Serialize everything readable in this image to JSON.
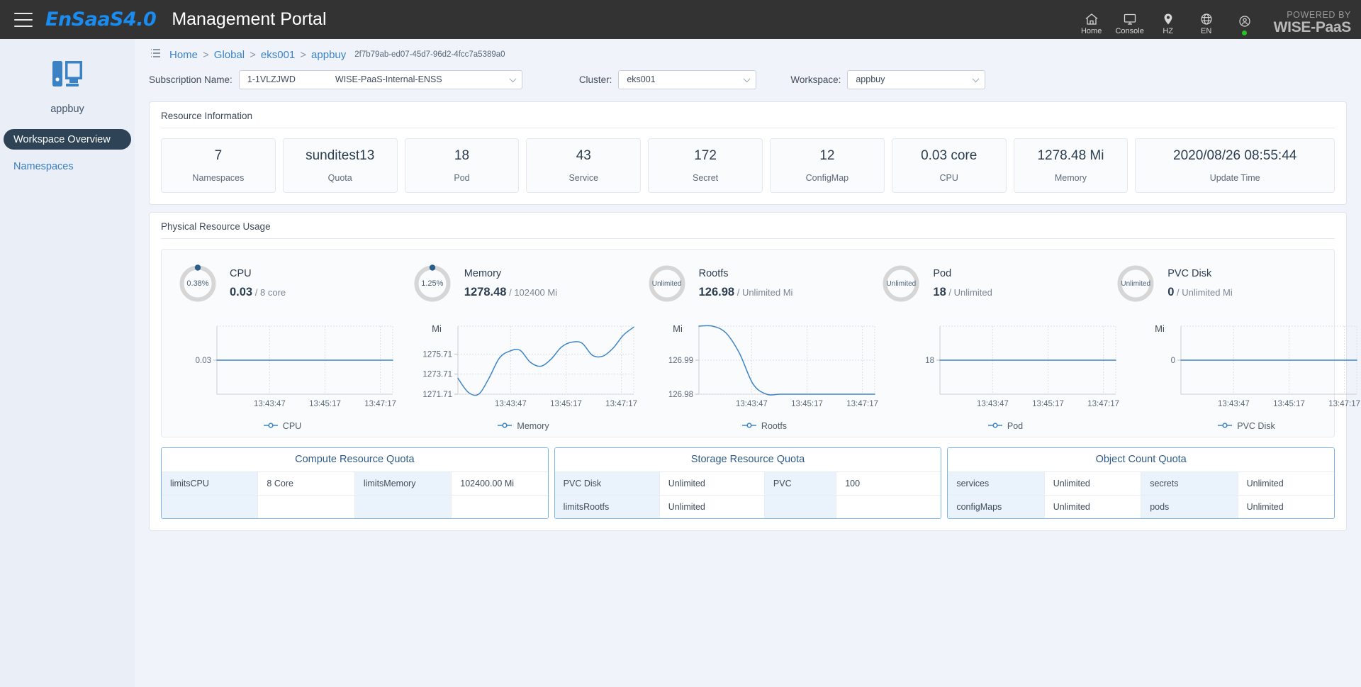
{
  "header": {
    "menu_icon": "hamburger-menu-icon",
    "brand": "EnSaaS4.0",
    "title": "Management Portal",
    "nav": [
      {
        "icon": "home-icon",
        "label": "Home"
      },
      {
        "icon": "monitor-icon",
        "label": "Console"
      },
      {
        "icon": "location-pin-icon",
        "label": "HZ"
      },
      {
        "icon": "globe-icon",
        "label": "EN"
      },
      {
        "icon": "user-account-icon",
        "label": ""
      }
    ],
    "powered_by_line1": "POWERED BY",
    "powered_by_line2": "WISE-PaaS",
    "status_color": "#25c425"
  },
  "sidebar": {
    "workspace_icon": "workspace-monitor-icon",
    "workspace_name": "appbuy",
    "items": [
      {
        "label": "Workspace Overview",
        "active": true
      },
      {
        "label": "Namespaces",
        "active": false
      }
    ]
  },
  "breadcrumb": {
    "list_icon": "list-view-icon",
    "items": [
      "Home",
      "Global",
      "eks001",
      "appbuy"
    ],
    "separator": ">",
    "id": "2f7b79ab-ed07-45d7-96d2-4fcc7a5389a0"
  },
  "filters": {
    "subscription": {
      "label": "Subscription Name:",
      "value_code": "1-1VLZJWD",
      "value_name": "WISE-PaaS-Internal-ENSS"
    },
    "cluster": {
      "label": "Cluster:",
      "value": "eks001"
    },
    "workspace": {
      "label": "Workspace:",
      "value": "appbuy"
    }
  },
  "resource_information": {
    "title": "Resource Information",
    "cards": [
      {
        "value": "7",
        "label": "Namespaces"
      },
      {
        "value": "sunditest13",
        "label": "Quota"
      },
      {
        "value": "18",
        "label": "Pod"
      },
      {
        "value": "43",
        "label": "Service"
      },
      {
        "value": "172",
        "label": "Secret"
      },
      {
        "value": "12",
        "label": "ConfigMap"
      },
      {
        "value": "0.03 core",
        "label": "CPU"
      },
      {
        "value": "1278.48 Mi",
        "label": "Memory"
      },
      {
        "value": "2020/08/26 08:55:44",
        "label": "Update Time"
      }
    ]
  },
  "physical_resource_usage": {
    "title": "Physical Resource Usage",
    "gauges": [
      {
        "ring_text": "0.38%",
        "percent": 0.38,
        "title": "CPU",
        "used": "0.03",
        "sep": "/",
        "total": "8 core"
      },
      {
        "ring_text": "1.25%",
        "percent": 1.25,
        "title": "Memory",
        "used": "1278.48",
        "sep": "/",
        "total": "102400 Mi"
      },
      {
        "ring_text": "Unlimited",
        "percent": 0,
        "title": "Rootfs",
        "used": "126.98",
        "sep": "/",
        "total": "Unlimited Mi"
      },
      {
        "ring_text": "Unlimited",
        "percent": 0,
        "title": "Pod",
        "used": "18",
        "sep": "/",
        "total": "Unlimited"
      },
      {
        "ring_text": "Unlimited",
        "percent": 0,
        "title": "PVC Disk",
        "used": "0",
        "sep": "/",
        "total": "Unlimited Mi"
      }
    ]
  },
  "chart_data": [
    {
      "type": "line",
      "title": "CPU",
      "legend": "CPU",
      "ylabel": "",
      "ytick_labels": [
        "0.03"
      ],
      "ytick_values": [
        0.03
      ],
      "ylim": [
        0.0295,
        0.0305
      ],
      "xtick_labels": [
        "13:43:47",
        "13:45:17",
        "13:47:17"
      ],
      "series": [
        {
          "name": "CPU",
          "values": [
            0.03,
            0.03,
            0.03,
            0.03,
            0.03,
            0.03,
            0.03,
            0.03,
            0.03,
            0.03,
            0.03,
            0.03,
            0.03
          ]
        }
      ],
      "color": "#3d85c6",
      "grid": true,
      "legend_position": "bottom"
    },
    {
      "type": "line",
      "title": "Memory",
      "legend": "Memory",
      "ylabel": "Mi",
      "ytick_labels": [
        "1271.71",
        "1273.71",
        "1275.71"
      ],
      "ytick_values": [
        1271.71,
        1273.71,
        1275.71
      ],
      "ylim": [
        1271.71,
        1278.5
      ],
      "xtick_labels": [
        "13:43:47",
        "13:45:17",
        "13:47:17"
      ],
      "series": [
        {
          "name": "Memory",
          "values": [
            1273.3,
            1271.9,
            1271.71,
            1273.3,
            1275.3,
            1276.0,
            1276.1,
            1274.9,
            1274.5,
            1275.2,
            1276.4,
            1276.9,
            1276.8,
            1275.6,
            1275.5,
            1276.3,
            1277.6,
            1278.4
          ]
        }
      ],
      "color": "#3d85c6",
      "grid": true,
      "legend_position": "bottom"
    },
    {
      "type": "line",
      "title": "Rootfs",
      "legend": "Rootfs",
      "ylabel": "Mi",
      "ytick_labels": [
        "126.98",
        "126.99"
      ],
      "ytick_values": [
        126.98,
        126.99
      ],
      "ylim": [
        126.98,
        127.0
      ],
      "xtick_labels": [
        "13:43:47",
        "13:45:17",
        "13:47:17"
      ],
      "series": [
        {
          "name": "Rootfs",
          "values": [
            127.0,
            127.0,
            126.998,
            126.992,
            126.983,
            126.98,
            126.98,
            126.98,
            126.98,
            126.98,
            126.98,
            126.98,
            126.98,
            126.98
          ]
        }
      ],
      "color": "#3d85c6",
      "grid": true,
      "legend_position": "bottom"
    },
    {
      "type": "line",
      "title": "Pod",
      "legend": "Pod",
      "ylabel": "",
      "ytick_labels": [
        "18"
      ],
      "ytick_values": [
        18
      ],
      "ylim": [
        17.5,
        18.5
      ],
      "xtick_labels": [
        "13:43:47",
        "13:45:17",
        "13:47:17"
      ],
      "series": [
        {
          "name": "Pod",
          "values": [
            18,
            18,
            18,
            18,
            18,
            18,
            18,
            18,
            18,
            18,
            18,
            18,
            18
          ]
        }
      ],
      "color": "#3d85c6",
      "grid": true,
      "legend_position": "bottom"
    },
    {
      "type": "line",
      "title": "PVC Disk",
      "legend": "PVC Disk",
      "ylabel": "Mi",
      "ytick_labels": [
        "0"
      ],
      "ytick_values": [
        0
      ],
      "ylim": [
        -0.5,
        0.5
      ],
      "xtick_labels": [
        "13:43:47",
        "13:45:17",
        "13:47:17"
      ],
      "series": [
        {
          "name": "PVC Disk",
          "values": [
            0,
            0,
            0,
            0,
            0,
            0,
            0,
            0,
            0,
            0,
            0,
            0,
            0
          ]
        }
      ],
      "color": "#3d85c6",
      "grid": true,
      "legend_position": "bottom"
    }
  ],
  "quota_tables": [
    {
      "title": "Compute Resource Quota",
      "rows": [
        [
          "limitsCPU",
          "8 Core",
          "limitsMemory",
          "102400.00 Mi"
        ],
        [
          "",
          "",
          "",
          ""
        ]
      ]
    },
    {
      "title": "Storage Resource Quota",
      "rows": [
        [
          "PVC Disk",
          "Unlimited",
          "PVC",
          "100"
        ],
        [
          "limitsRootfs",
          "Unlimited",
          "",
          ""
        ]
      ]
    },
    {
      "title": "Object Count Quota",
      "rows": [
        [
          "services",
          "Unlimited",
          "secrets",
          "Unlimited"
        ],
        [
          "configMaps",
          "Unlimited",
          "pods",
          "Unlimited"
        ]
      ]
    }
  ]
}
